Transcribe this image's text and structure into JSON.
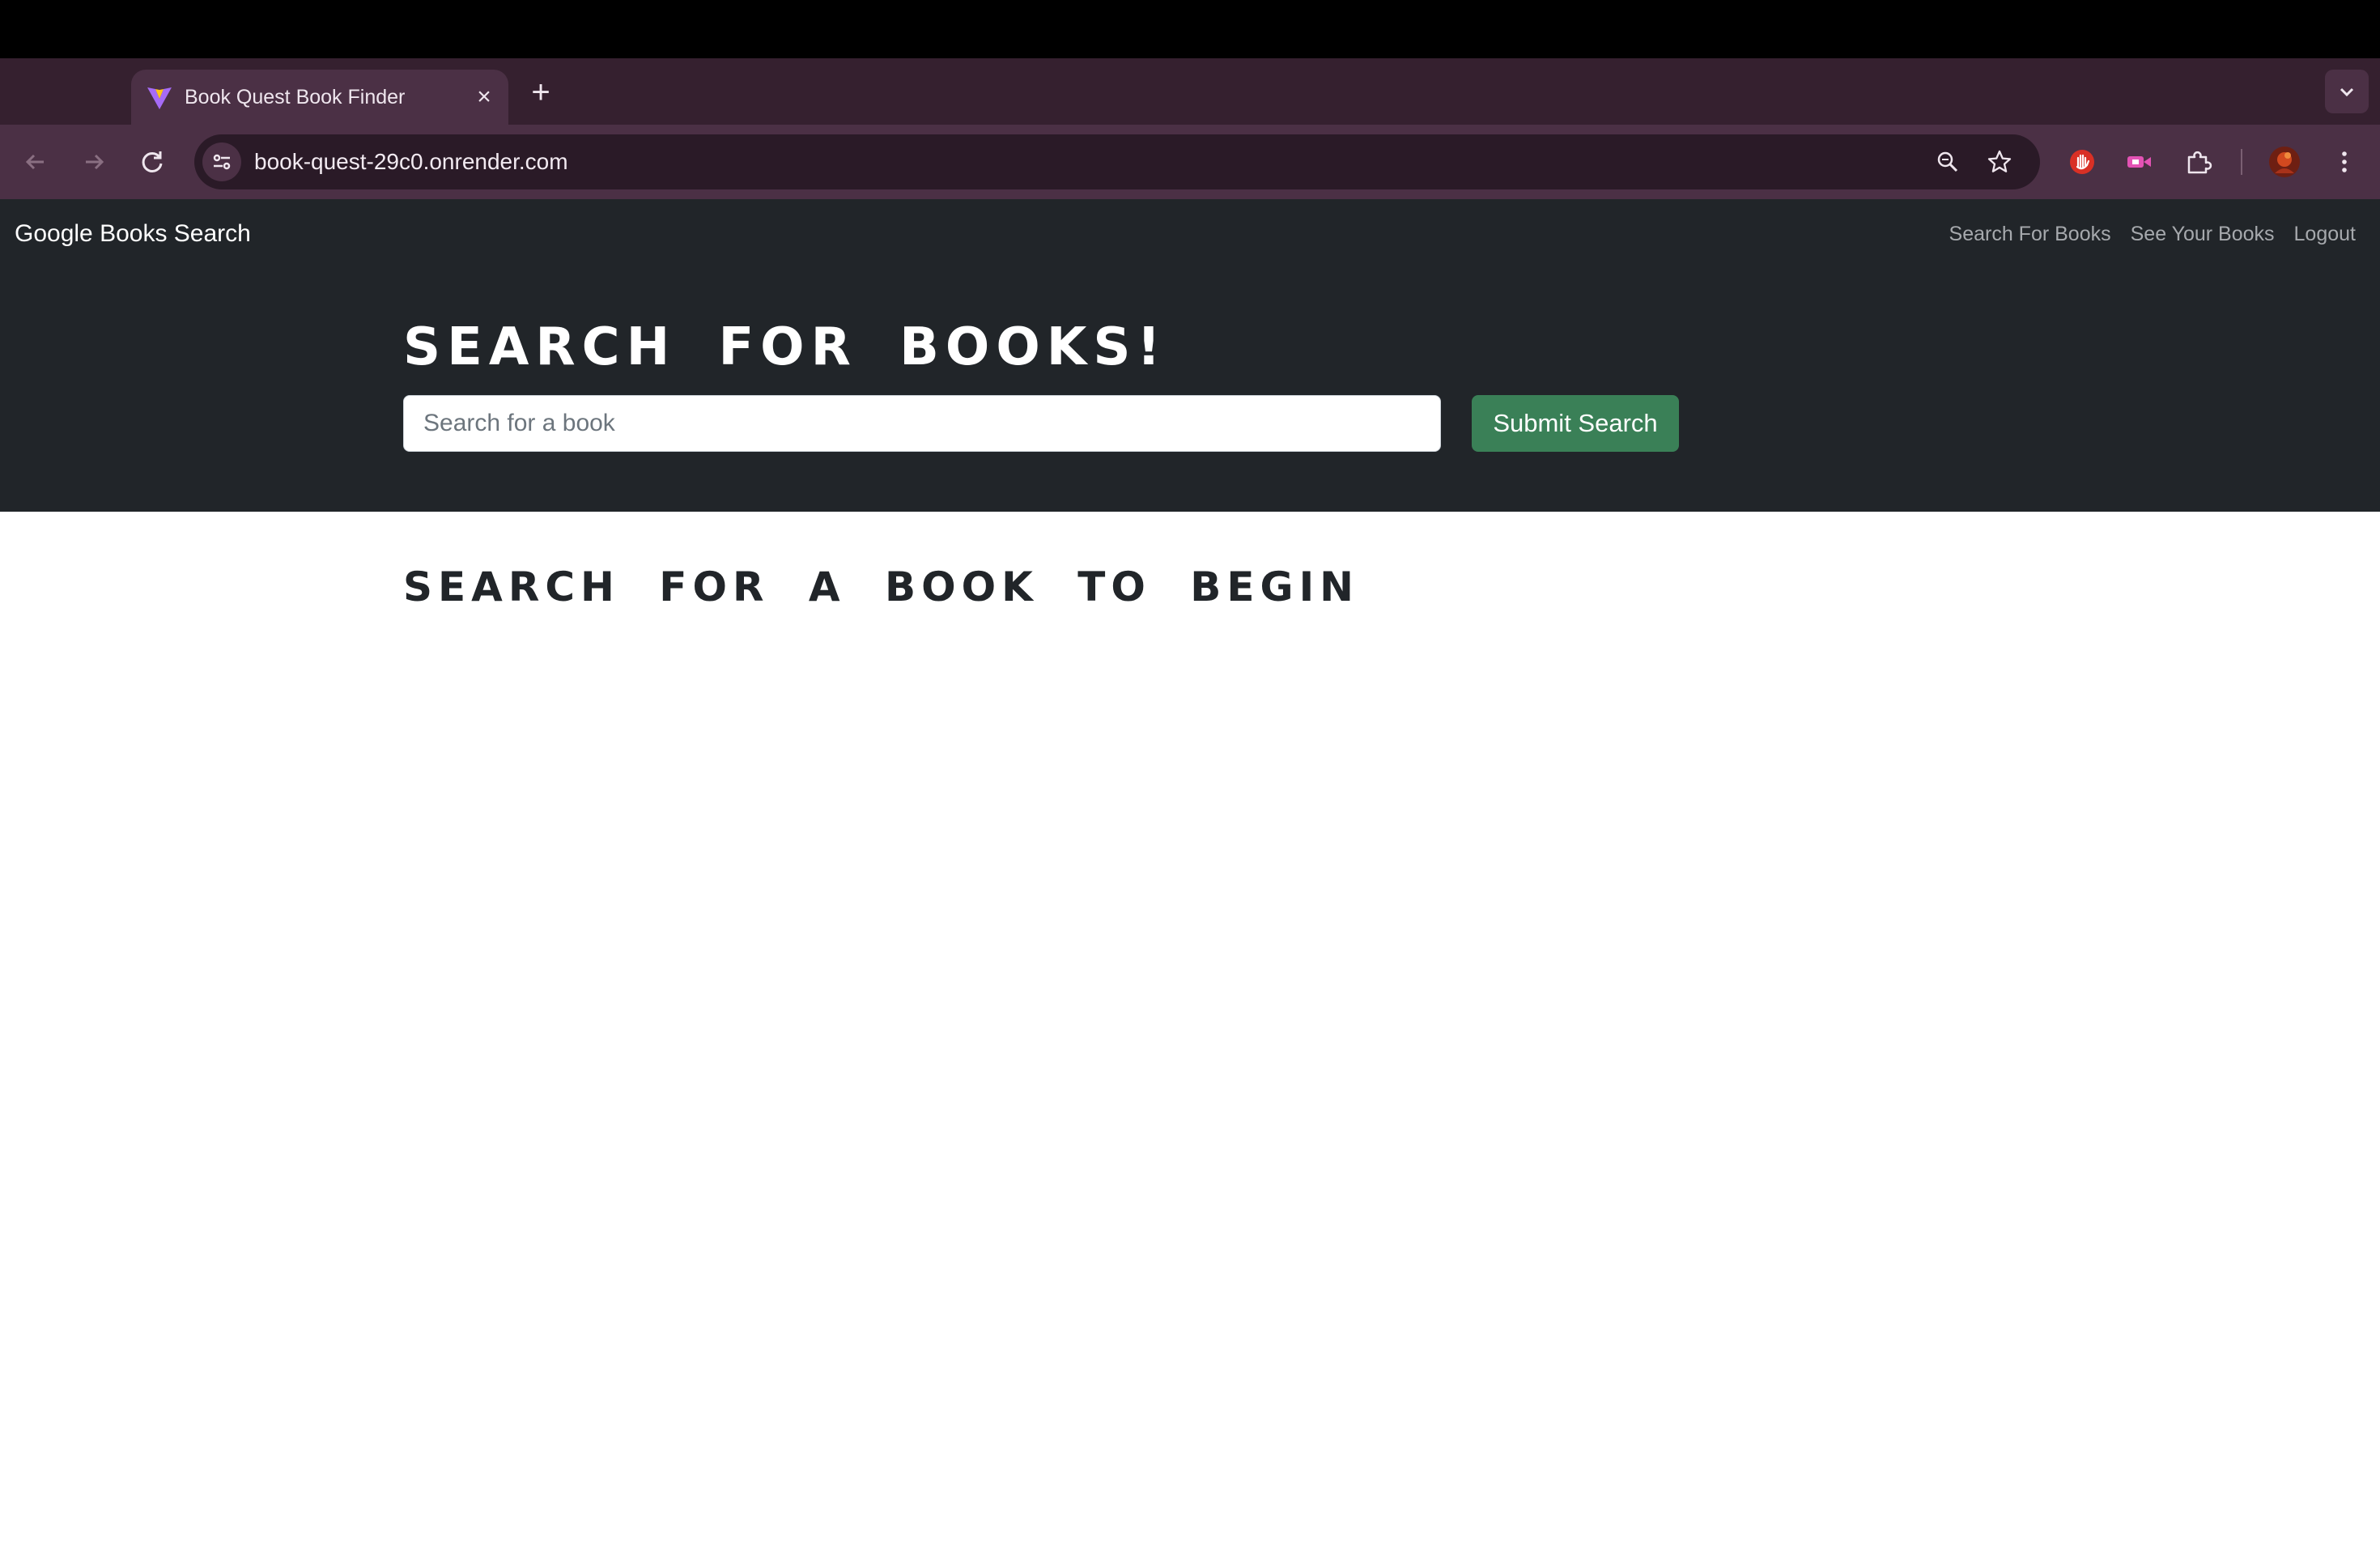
{
  "browser": {
    "tab": {
      "title": "Book Quest Book Finder",
      "close_glyph": "×"
    },
    "new_tab_glyph": "+",
    "address": {
      "url": "book-quest-29c0.onrender.com"
    },
    "icons": [
      "back-icon",
      "forward-icon",
      "reload-icon",
      "site-info-icon",
      "zoom-icon",
      "bookmark-star-icon",
      "extension-red-hand-icon",
      "extension-video-icon",
      "extensions-puzzle-icon",
      "profile-avatar-icon",
      "more-menu-icon",
      "tab-search-icon"
    ]
  },
  "navbar": {
    "brand": "Google Books Search",
    "links": [
      {
        "label": "Search For Books"
      },
      {
        "label": "See Your Books"
      },
      {
        "label": "Logout"
      }
    ]
  },
  "hero": {
    "title": "SEARCH FOR BOOKS!",
    "search": {
      "placeholder": "Search for a book",
      "value": ""
    },
    "submit_label": "Submit Search"
  },
  "results": {
    "heading": "SEARCH FOR A BOOK TO BEGIN"
  },
  "colors": {
    "chrome_frame": "#35202f",
    "chrome_toolbar": "#4b3045",
    "navbar_bg": "#212529",
    "submit_button": "#3a8057"
  }
}
